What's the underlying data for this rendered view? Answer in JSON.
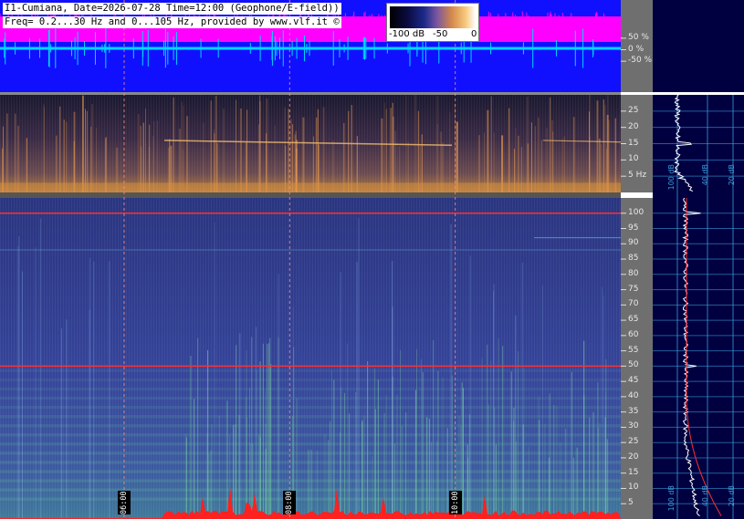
{
  "header": {
    "line1": "I1-Cumiana, Date=2026-07-28 Time=12:00 (Geophone/E-field))",
    "line2": "Freq= 0.2...30 Hz and 0...105 Hz, provided by www.vlf.it ©"
  },
  "colorbar": {
    "labels": [
      "-100 dB",
      "-50",
      "0"
    ]
  },
  "chart_data": [
    {
      "type": "line",
      "panel": "waveform",
      "y_ticks": [
        "50 %",
        "0 %",
        "-50 %"
      ],
      "y_values": [
        50,
        0,
        -50
      ],
      "ylim": [
        -100,
        100
      ],
      "colors": {
        "background": "#1010ff",
        "trace_upper": "#ff00ff",
        "trace_center": "#00d8ff"
      }
    },
    {
      "type": "heatmap",
      "panel": "low-frequency spectrogram",
      "y_ticks": [
        "25",
        "20",
        "15",
        "10",
        "5 Hz"
      ],
      "y_values": [
        25,
        20,
        15,
        10,
        5
      ],
      "ylim": [
        0,
        30
      ],
      "spectrum_labels": [
        "100 dB",
        "40 dB",
        "20 dB"
      ]
    },
    {
      "type": "heatmap",
      "panel": "spectrogram",
      "y_ticks": [
        "100",
        "95",
        "90",
        "85",
        "80",
        "75",
        "70",
        "65",
        "60",
        "55",
        "50",
        "45",
        "40",
        "35",
        "30",
        "25",
        "20",
        "15",
        "10",
        "5"
      ],
      "y_values": [
        100,
        95,
        90,
        85,
        80,
        75,
        70,
        65,
        60,
        55,
        50,
        45,
        40,
        35,
        30,
        25,
        20,
        15,
        10,
        5
      ],
      "ylim": [
        0,
        105
      ],
      "time_markers": [
        "06:00",
        "08:00",
        "10:00"
      ],
      "time_values_h": [
        6,
        8,
        10
      ],
      "xlim_h": [
        4.5,
        12
      ],
      "lines_hz": [
        100,
        50
      ],
      "spectrum_labels": [
        "100 dB",
        "40 dB",
        "20 dB"
      ],
      "colors": {
        "mains_line": "#ff3030",
        "activity": "#ff2020"
      }
    }
  ]
}
